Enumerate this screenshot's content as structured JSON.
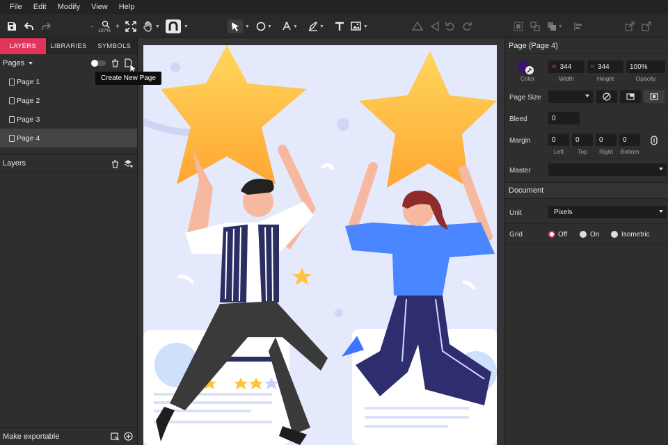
{
  "menu": [
    "File",
    "Edit",
    "Modify",
    "View",
    "Help"
  ],
  "toolbar": {
    "zoom_level": "107%"
  },
  "left_panel": {
    "tabs": [
      "LAYERS",
      "LIBRARIES",
      "SYMBOLS"
    ],
    "active_tab": "LAYERS",
    "pages_label": "Pages",
    "pages": [
      "Page 1",
      "Page 2",
      "Page 3",
      "Page 4"
    ],
    "selected_page": "Page 4",
    "layers_label": "Layers",
    "make_exportable": "Make exportable"
  },
  "tooltip": "Create New Page",
  "right_panel": {
    "title": "Page (Page 4)",
    "fill": {
      "color_label": "Color",
      "color": "#3a1466"
    },
    "width": {
      "label": "Width",
      "value": "344"
    },
    "height": {
      "label": "Height",
      "value": "344"
    },
    "opacity": {
      "label": "Opacity",
      "value": "100%"
    },
    "page_size_label": "Page Size",
    "bleed": {
      "label": "Bleed",
      "value": "0"
    },
    "margin": {
      "label": "Margin",
      "fields": [
        {
          "label": "Left",
          "value": "0"
        },
        {
          "label": "Top",
          "value": "0"
        },
        {
          "label": "Right",
          "value": "0"
        },
        {
          "label": "Bottom",
          "value": "0"
        }
      ]
    },
    "master_label": "Master",
    "document_label": "Document",
    "unit": {
      "label": "Unit",
      "value": "Pixels"
    },
    "grid": {
      "label": "Grid",
      "options": [
        "Off",
        "On",
        "Isometric"
      ],
      "selected": "Off"
    }
  },
  "colors": {
    "accent": "#e0345a",
    "canvas_bg": "#e4e9fb",
    "star": "#ffc23d"
  }
}
